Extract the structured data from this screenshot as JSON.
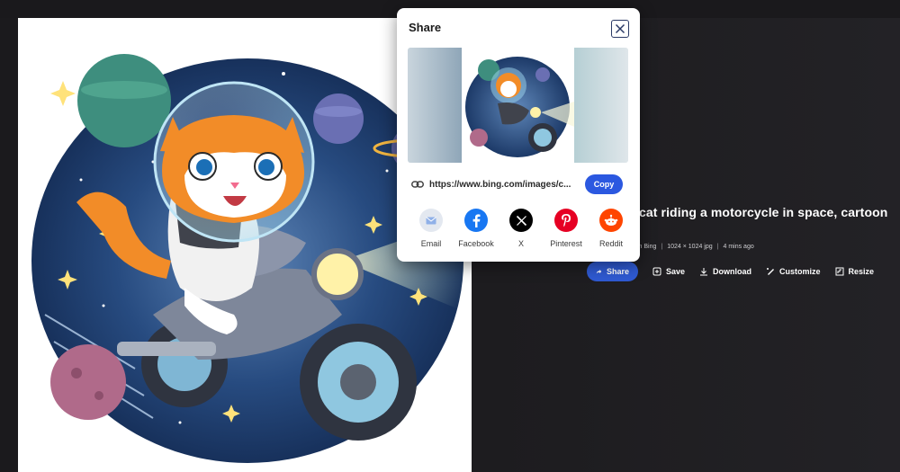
{
  "dialog": {
    "title": "Share",
    "link_url": "https://www.bing.com/images/c...",
    "copy_label": "Copy",
    "social": [
      {
        "label": "Email",
        "icon": "email-icon",
        "color": "#e3e8f0"
      },
      {
        "label": "Facebook",
        "icon": "facebook-icon",
        "color": "#1877f2"
      },
      {
        "label": "X",
        "icon": "x-icon",
        "color": "#000000"
      },
      {
        "label": "Pinterest",
        "icon": "pinterest-icon",
        "color": "#e60023"
      },
      {
        "label": "Reddit",
        "icon": "reddit-icon",
        "color": "#ff4500"
      }
    ]
  },
  "details": {
    "title_fragment": "cat riding a motorcycle in space, cartoon",
    "meta_source": "in Bing",
    "meta_size": "1024 × 1024 jpg",
    "meta_time": "4 mins ago"
  },
  "actions": {
    "share": "Share",
    "save": "Save",
    "download": "Download",
    "customize": "Customize",
    "resize": "Resize"
  },
  "colors": {
    "accent": "#2b58e0",
    "background": "#1d1c1f"
  }
}
